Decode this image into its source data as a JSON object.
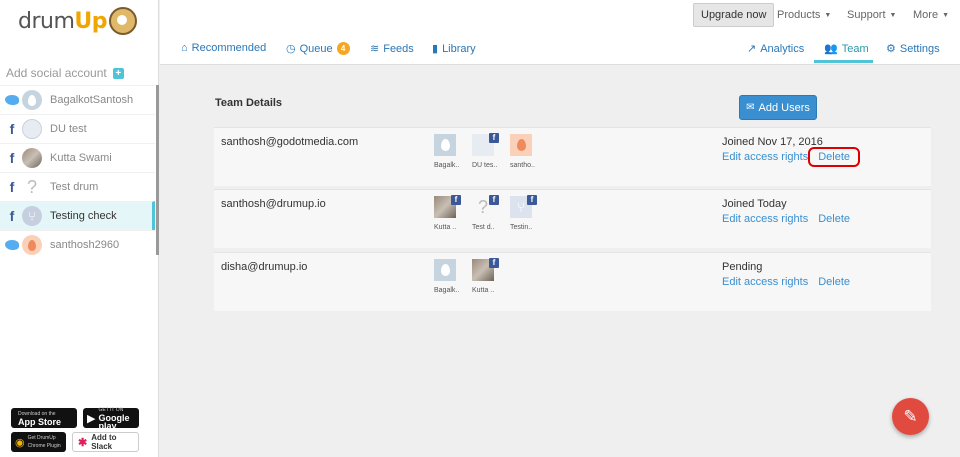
{
  "sidebar": {
    "logo": {
      "text_pre": "drum",
      "text_post": "Up"
    },
    "add_social_label": "Add social account",
    "accounts": [
      {
        "network": "twitter",
        "name": "BagalkotSantosh",
        "avatar": "egg-blue"
      },
      {
        "network": "facebook",
        "name": "DU test",
        "avatar": "pin"
      },
      {
        "network": "facebook",
        "name": "Kutta Swami",
        "avatar": "photo"
      },
      {
        "network": "facebook",
        "name": "Test drum",
        "avatar": "q"
      },
      {
        "network": "facebook",
        "name": "Testing check",
        "avatar": "fork",
        "active": true
      },
      {
        "network": "twitter",
        "name": "santhosh2960",
        "avatar": "egg-orange"
      }
    ],
    "badges": {
      "app_store": {
        "small": "Download on the",
        "big": "App Store"
      },
      "google_play": {
        "small": "GET IT ON",
        "big": "Google play"
      },
      "chrome": {
        "small": "Get DrumUp",
        "big": "Chrome Plugin"
      },
      "slack": "Add to Slack"
    }
  },
  "topbar": {
    "upgrade_label": "Upgrade now",
    "menus": [
      "Products",
      "Support",
      "More"
    ],
    "tabs": {
      "recommended": "Recommended",
      "queue": "Queue",
      "queue_count": "4",
      "feeds": "Feeds",
      "library": "Library",
      "analytics": "Analytics",
      "team": "Team",
      "settings": "Settings"
    }
  },
  "team": {
    "title": "Team Details",
    "add_users_label": "Add Users",
    "members": [
      {
        "email": "santhosh@godotmedia.com",
        "status": "Joined Nov 17, 2016",
        "edit_label": "Edit access rights",
        "delete_label": "Delete",
        "accounts": [
          {
            "label": "Bagalk..",
            "avatar": "egg-blue",
            "fb": false
          },
          {
            "label": "DU tes..",
            "avatar": "pin",
            "fb": true
          },
          {
            "label": "santho..",
            "avatar": "egg-orange",
            "fb": false
          }
        ]
      },
      {
        "email": "santhosh@drumup.io",
        "status": "Joined Today",
        "edit_label": "Edit access rights",
        "delete_label": "Delete",
        "accounts": [
          {
            "label": "Kutta ..",
            "avatar": "photo",
            "fb": true
          },
          {
            "label": "Test d..",
            "avatar": "q",
            "fb": true
          },
          {
            "label": "Testin..",
            "avatar": "fork",
            "fb": true
          }
        ]
      },
      {
        "email": "disha@drumup.io",
        "status": "Pending",
        "edit_label": "Edit access rights",
        "delete_label": "Delete",
        "accounts": [
          {
            "label": "Bagalk..",
            "avatar": "egg-blue",
            "fb": false
          },
          {
            "label": "Kutta ..",
            "avatar": "photo",
            "fb": true
          }
        ]
      }
    ]
  },
  "colors": {
    "accent": "#4fc3d7",
    "link": "#3a8fd0",
    "primary_button": "#3a8fd0",
    "fab": "#e04a3f",
    "highlight": "#dd0000"
  }
}
